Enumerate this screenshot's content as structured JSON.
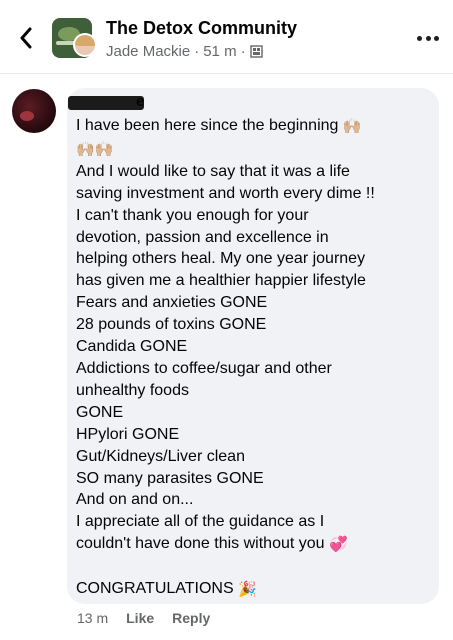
{
  "header": {
    "back_icon": "chevron-left-icon",
    "group_name": "The Detox Community",
    "author": "Jade Mackie",
    "time": "51 m",
    "separator": "·",
    "audience_icon": "group-icon",
    "more_icon": "more-dots-icon"
  },
  "comment": {
    "name_visible_tail": "e",
    "lines": [
      "I have been here since the beginning",
      "",
      "And I would like to say that it was a life",
      "saving investment and worth every dime !!",
      "I can't thank you enough for your",
      "devotion, passion and excellence in",
      "helping others heal. My one year journey",
      "has given me a healthier happier lifestyle",
      "Fears and anxieties GONE",
      "28 pounds of toxins GONE",
      "Candida GONE",
      "Addictions to coffee/sugar and other",
      "unhealthy foods",
      "GONE",
      "HPylori GONE",
      "Gut/Kidneys/Liver clean",
      "SO many parasites GONE",
      "And on and on...",
      "I appreciate all of the guidance as I",
      "couldn't have done this without you",
      "",
      "CONGRATULATIONS"
    ],
    "emojis": {
      "raised_hands": "🙌🏼",
      "heart": "💞",
      "party": "🎉"
    }
  },
  "actions": {
    "time": "13 m",
    "like": "Like",
    "reply": "Reply"
  }
}
